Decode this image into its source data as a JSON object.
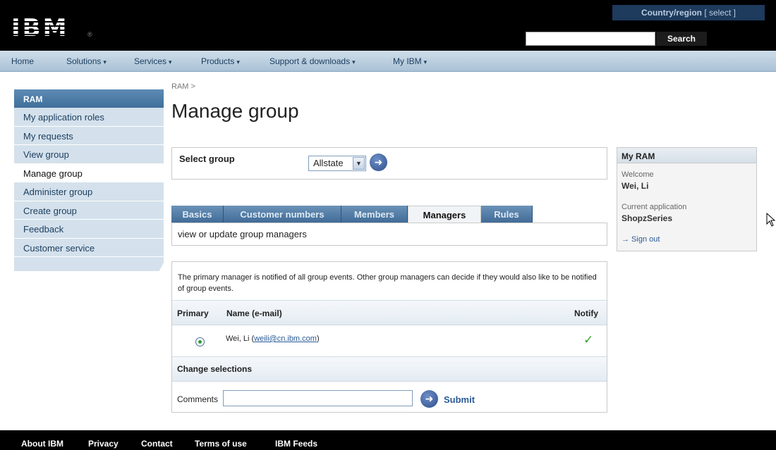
{
  "header": {
    "logo": "IBM",
    "country_label": "Country/region",
    "country_select": "[ select ]",
    "search_placeholder": "",
    "search_button": "Search"
  },
  "nav": {
    "items": [
      {
        "label": "Home",
        "caret": ""
      },
      {
        "label": "Solutions",
        "caret": "▾"
      },
      {
        "label": "Services",
        "caret": "▾"
      },
      {
        "label": "Products",
        "caret": "▾"
      },
      {
        "label": "Support & downloads",
        "caret": "▾"
      },
      {
        "label": "My IBM",
        "caret": "▾"
      }
    ]
  },
  "sidebar": {
    "heading": "RAM",
    "items": [
      {
        "label": "My application roles"
      },
      {
        "label": "My requests"
      },
      {
        "label": "View group"
      },
      {
        "label": "Manage group",
        "active": true
      },
      {
        "label": "Administer group"
      },
      {
        "label": "Create group"
      },
      {
        "label": "Feedback"
      },
      {
        "label": "Customer service"
      }
    ]
  },
  "main": {
    "breadcrumb": "RAM  >",
    "title": "Manage group",
    "select_group": {
      "label": "Select group",
      "value": "Allstate"
    },
    "tabs": [
      {
        "label": "Basics"
      },
      {
        "label": "Customer numbers"
      },
      {
        "label": "Members"
      },
      {
        "label": "Managers",
        "active": true
      },
      {
        "label": "Rules"
      }
    ],
    "tab_description": "view or update group managers",
    "managers": {
      "info": "The primary manager is notified of all group events. Other group managers can decide if they would also like to be notified of group events.",
      "col_primary": "Primary",
      "col_name": "Name (e-mail)",
      "col_notify": "Notify",
      "rows": [
        {
          "name": "Wei, Li (",
          "email": "weili@cn.ibm.com",
          "close": ")",
          "primary": true,
          "notify": true
        }
      ],
      "change_label": "Change selections",
      "comments_label": "Comments",
      "comments_value": "",
      "submit_label": "Submit"
    }
  },
  "myram": {
    "heading": "My RAM",
    "welcome_label": "Welcome",
    "user": "Wei, Li",
    "app_label": "Current application",
    "app_value": "ShopzSeries",
    "signout": "→ Sign out"
  },
  "footer": {
    "items": [
      {
        "label": "About IBM"
      },
      {
        "label": "Privacy"
      },
      {
        "label": "Contact"
      },
      {
        "label": "Terms of use"
      },
      {
        "label": "IBM Feeds"
      }
    ]
  },
  "colors": {
    "masthead": "#000000",
    "nav_bar": "#aac2d6",
    "tab_blue": "#3f6a96",
    "link": "#2a5a96",
    "check_green": "#33a02c"
  }
}
